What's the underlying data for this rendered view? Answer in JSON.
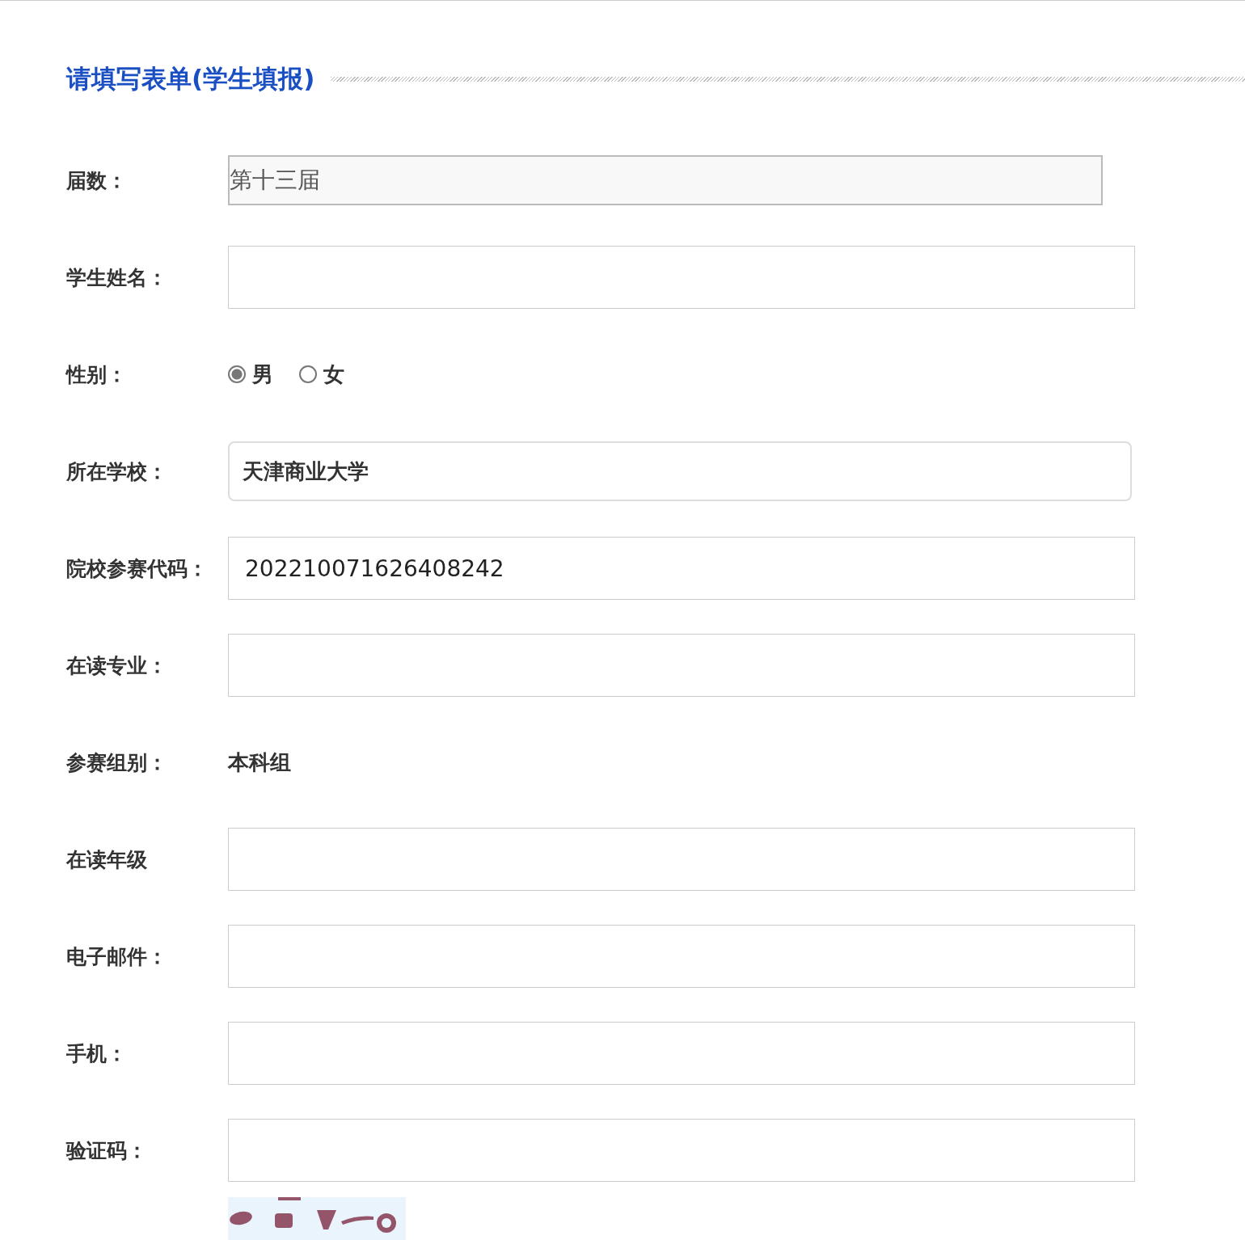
{
  "title": "请填写表单(学生填报)",
  "fields": [
    {
      "kind": "readonly",
      "label": "届数：",
      "value": "第十三届"
    },
    {
      "kind": "text",
      "label": "学生姓名："
    },
    {
      "kind": "radio",
      "label": "性别：",
      "options": [
        {
          "label": "男",
          "selected": true
        },
        {
          "label": "女",
          "selected": false
        }
      ]
    },
    {
      "kind": "select",
      "label": "所在学校：",
      "value": "天津商业大学"
    },
    {
      "kind": "text",
      "label": "院校参赛代码：",
      "value": "202210071626408242"
    },
    {
      "kind": "text",
      "label": "在读专业："
    },
    {
      "kind": "static",
      "label": "参赛组别：",
      "value": "本科组"
    },
    {
      "kind": "text",
      "label": "在读年级"
    },
    {
      "kind": "text",
      "label": "电子邮件："
    },
    {
      "kind": "text",
      "label": "手机："
    },
    {
      "kind": "text",
      "label": "验证码："
    }
  ]
}
